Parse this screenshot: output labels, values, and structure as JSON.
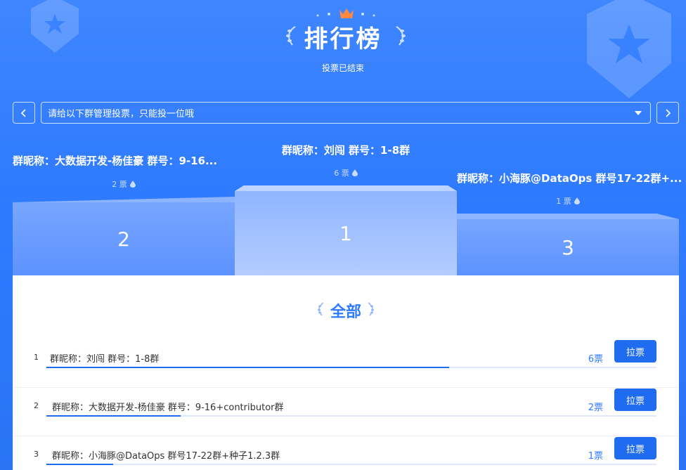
{
  "header": {
    "title": "排行榜",
    "subtitle": "投票已结束"
  },
  "selector": {
    "value": "请给以下群管理投票，只能投一位哦"
  },
  "podium": [
    {
      "rank": "2",
      "label": "群昵称：大数据开发-杨佳豪 群号：9-16...",
      "votes": "2 票"
    },
    {
      "rank": "1",
      "label": "群昵称：刘闯 群号：1-8群",
      "votes": "6 票"
    },
    {
      "rank": "3",
      "label": "群昵称：小海豚@DataOps 群号17-22群+...",
      "votes": "1 票"
    }
  ],
  "list": {
    "title": "全部",
    "button_label": "拉票",
    "rows": [
      {
        "rank": "1",
        "name": "群昵称：刘闯 群号：1-8群",
        "votes": "6票",
        "share": 0.66
      },
      {
        "rank": "2",
        "name": "群昵称：大数据开发-杨佳豪 群号：9-16+contributor群",
        "votes": "2票",
        "share": 0.22
      },
      {
        "rank": "3",
        "name": "群昵称：小海豚@DataOps 群号17-22群+种子1.2.3群",
        "votes": "1票",
        "share": 0.11
      }
    ]
  },
  "colors": {
    "accent": "#1f6cf0",
    "background": "#2f7bff"
  }
}
